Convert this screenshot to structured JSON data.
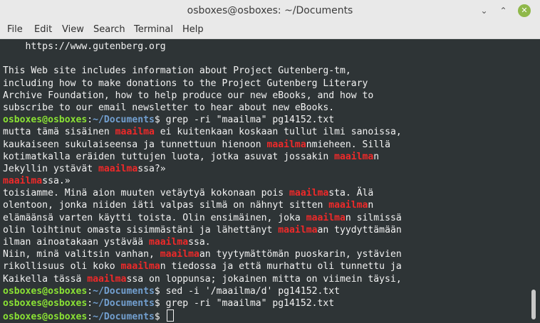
{
  "window": {
    "title": "osboxes@osboxes: ~/Documents",
    "minimize_glyph": "⌄",
    "maximize_glyph": "⌃",
    "close_glyph": "✕"
  },
  "menu": [
    "File",
    "Edit",
    "View",
    "Search",
    "Terminal",
    "Help"
  ],
  "prompt": {
    "user": "osboxes@osboxes",
    "sep": ":",
    "path": "~/Documents",
    "symbol": "$"
  },
  "terminal_lines": [
    {
      "segments": [
        {
          "t": "    https://www.gutenberg.org"
        }
      ]
    },
    {
      "segments": [
        {
          "t": ""
        }
      ]
    },
    {
      "segments": [
        {
          "t": "This Web site includes information about Project Gutenberg-tm,"
        }
      ]
    },
    {
      "segments": [
        {
          "t": "including how to make donations to the Project Gutenberg Literary"
        }
      ]
    },
    {
      "segments": [
        {
          "t": "Archive Foundation, how to help produce our new eBooks, and how to"
        }
      ]
    },
    {
      "segments": [
        {
          "t": "subscribe to our email newsletter to hear about new eBooks."
        }
      ]
    },
    {
      "prompt": true,
      "segments": [
        {
          "t": " grep -ri \"maailma\" pg14152.txt"
        }
      ]
    },
    {
      "segments": [
        {
          "t": "mutta tämä sisäinen "
        },
        {
          "t": "maailma",
          "hl": true
        },
        {
          "t": " ei kuitenkaan koskaan tullut ilmi sanoissa,"
        }
      ]
    },
    {
      "segments": [
        {
          "t": "kaukaiseen sukulaiseensa ja tunnettuun hienoon "
        },
        {
          "t": "maailma",
          "hl": true
        },
        {
          "t": "nmieheen. Sillä"
        }
      ]
    },
    {
      "segments": [
        {
          "t": "kotimatkalla eräiden tuttujen luota, jotka asuvat jossakin "
        },
        {
          "t": "maailma",
          "hl": true
        },
        {
          "t": "n"
        }
      ]
    },
    {
      "segments": [
        {
          "t": "Jekyllin ystävät "
        },
        {
          "t": "maailma",
          "hl": true
        },
        {
          "t": "ssa?»"
        }
      ]
    },
    {
      "segments": [
        {
          "t": "maailma",
          "hl": true
        },
        {
          "t": "ssa.»"
        }
      ]
    },
    {
      "segments": [
        {
          "t": "toisiamme. Minä aion muuten vetäytyä kokonaan pois "
        },
        {
          "t": "maailma",
          "hl": true
        },
        {
          "t": "sta. Älä"
        }
      ]
    },
    {
      "segments": [
        {
          "t": "olentoon, jonka niiden iäti valpas silmä on nähnyt sitten "
        },
        {
          "t": "maailma",
          "hl": true
        },
        {
          "t": "n"
        }
      ]
    },
    {
      "segments": [
        {
          "t": "elämäänsä varten käytti toista. Olin ensimäinen, joka "
        },
        {
          "t": "maailma",
          "hl": true
        },
        {
          "t": "n silmissä"
        }
      ]
    },
    {
      "segments": [
        {
          "t": "olin loihtinut omasta sisimmästäni ja lähettänyt "
        },
        {
          "t": "maailma",
          "hl": true
        },
        {
          "t": "an tyydyttämään"
        }
      ]
    },
    {
      "segments": [
        {
          "t": "ilman ainoatakaan ystävää "
        },
        {
          "t": "maailma",
          "hl": true
        },
        {
          "t": "ssa."
        }
      ]
    },
    {
      "segments": [
        {
          "t": "Niin, minä valitsin vanhan, "
        },
        {
          "t": "maailma",
          "hl": true
        },
        {
          "t": "an tyytymättömän puoskarin, ystävien"
        }
      ]
    },
    {
      "segments": [
        {
          "t": "rikollisuus oli koko "
        },
        {
          "t": "maailma",
          "hl": true
        },
        {
          "t": "n tiedossa ja että murhattu oli tunnettu ja"
        }
      ]
    },
    {
      "segments": [
        {
          "t": "Kaikella tässä "
        },
        {
          "t": "maailma",
          "hl": true
        },
        {
          "t": "ssa on loppunsa; jokainen mitta on viimein täysi,"
        }
      ]
    },
    {
      "prompt": true,
      "segments": [
        {
          "t": " sed -i '/maailma/d' pg14152.txt"
        }
      ]
    },
    {
      "prompt": true,
      "segments": [
        {
          "t": " grep -ri \"maailma\" pg14152.txt"
        }
      ]
    },
    {
      "prompt": true,
      "cursor": true,
      "segments": [
        {
          "t": " "
        }
      ]
    }
  ],
  "colors": {
    "prompt_user": "#8ae234",
    "prompt_path": "#729fcf",
    "match_highlight": "#ef2929",
    "terminal_bg": "#2e3436",
    "text": "#f2f2f2"
  }
}
